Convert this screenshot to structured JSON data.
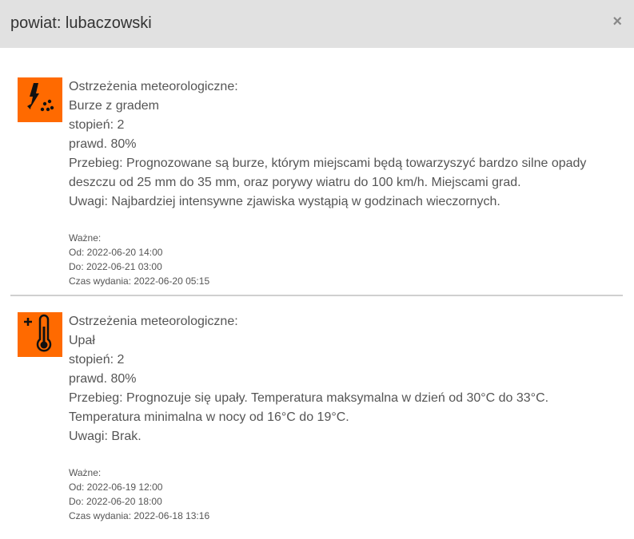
{
  "header": {
    "title": "powiat: lubaczowski",
    "close_label": "×"
  },
  "warnings": [
    {
      "icon": "storm-hail-icon",
      "category": "Ostrzeżenia meteorologiczne:",
      "type": "Burze z gradem",
      "level": "stopień: 2",
      "probability": "prawd. 80%",
      "course_line1": "Przebieg: Prognozowane są burze, którym miejscami będą towarzyszyć bardzo silne opady",
      "course_line2": "deszczu od 25 mm do 35 mm, oraz porywy wiatru do 100 km/h. Miejscami grad.",
      "remarks": "Uwagi: Najbardziej intensywne zjawiska wystąpią w godzinach wieczornych.",
      "valid_label": "Ważne:",
      "from": "Od: 2022-06-20 14:00",
      "to": "Do: 2022-06-21 03:00",
      "issued": "Czas wydania: 2022-06-20 05:15"
    },
    {
      "icon": "heat-thermometer-icon",
      "category": "Ostrzeżenia meteorologiczne:",
      "type": "Upał",
      "level": "stopień: 2",
      "probability": "prawd. 80%",
      "course_line1": "Przebieg: Prognozuje się upały. Temperatura maksymalna w dzień od 30°C do 33°C.",
      "course_line2": "Temperatura minimalna w nocy od 16°C do 19°C.",
      "remarks": "Uwagi: Brak.",
      "valid_label": "Ważne:",
      "from": "Od: 2022-06-19 12:00",
      "to": "Do: 2022-06-20 18:00",
      "issued": "Czas wydania: 2022-06-18 13:16"
    }
  ],
  "colors": {
    "header_bg": "#e1e1e1",
    "icon_bg": "#ff6a00",
    "text": "#555555"
  }
}
